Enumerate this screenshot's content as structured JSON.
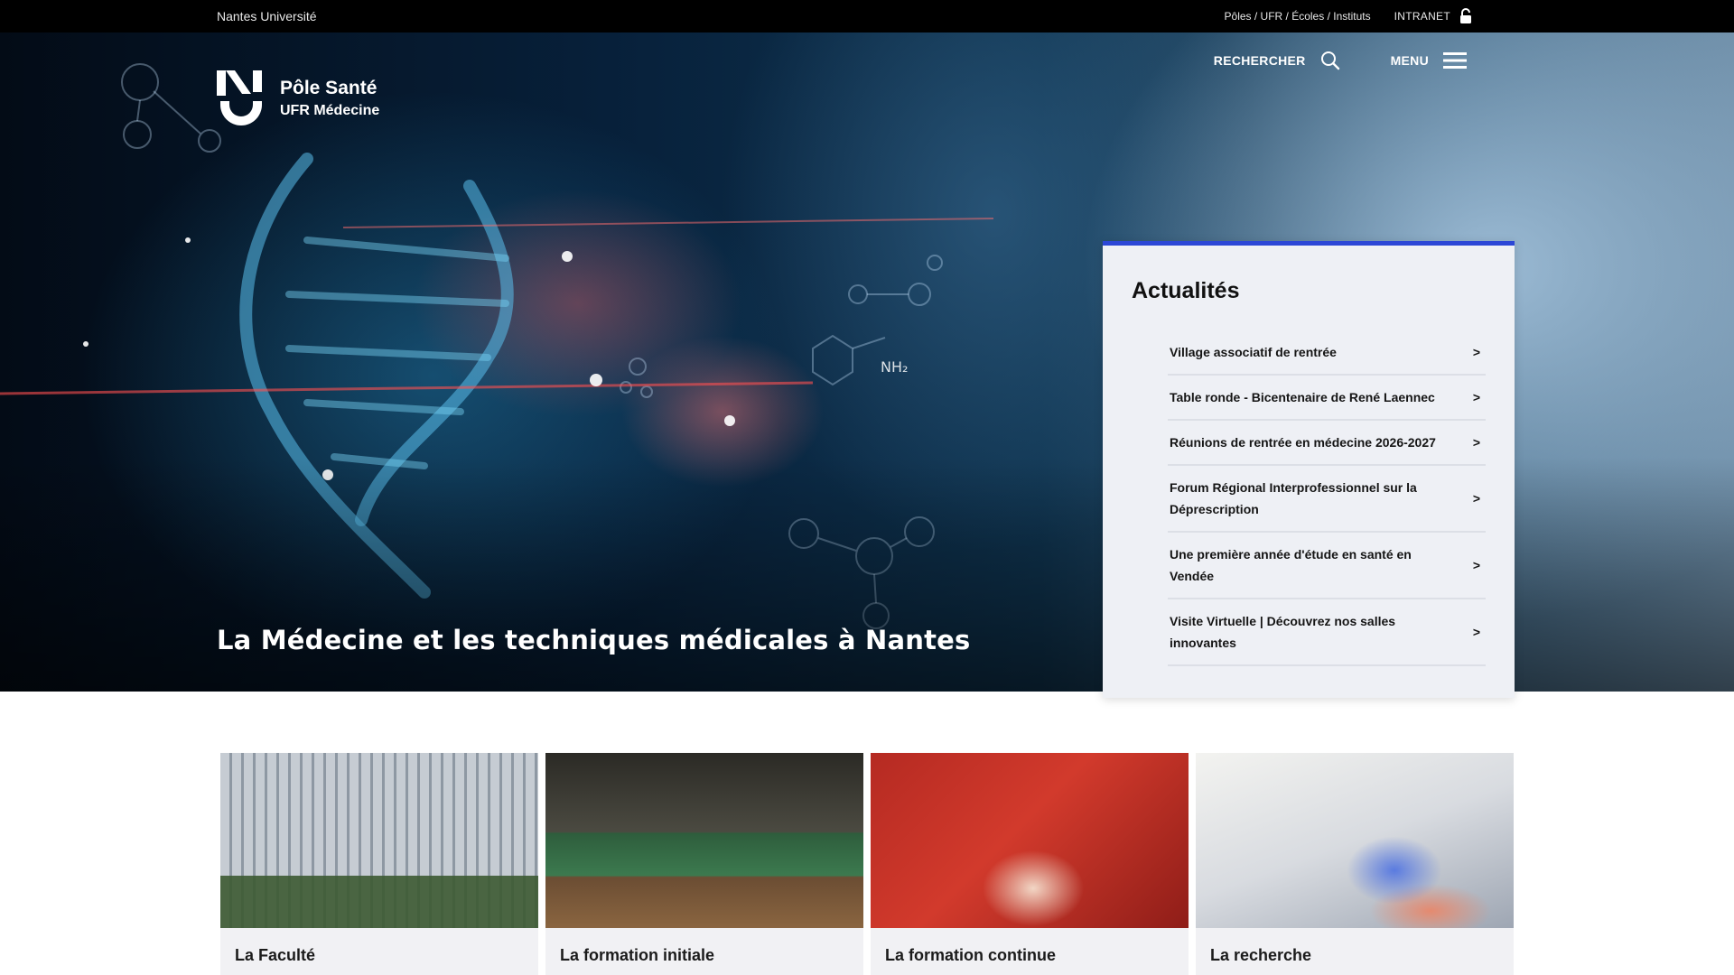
{
  "topbar": {
    "university": "Nantes Université",
    "poles_link": "Pôles / UFR / Écoles / Instituts",
    "intranet": "INTRANET"
  },
  "header": {
    "brand_title": "Pôle Santé",
    "brand_subtitle": "UFR Médecine",
    "search_label": "RECHERCHER",
    "menu_label": "MENU"
  },
  "hero": {
    "title": "La Médecine et les techniques médicales à Nantes"
  },
  "news": {
    "heading": "Actualités",
    "items": [
      {
        "label": "Village associatif de rentrée"
      },
      {
        "label": "Table ronde - Bicentenaire de René Laennec"
      },
      {
        "label": "Réunions de rentrée en médecine 2026-2027"
      },
      {
        "label": "Forum Régional Interprofessionnel sur la Déprescription"
      },
      {
        "label": "Une première année d'étude en santé en Vendée"
      },
      {
        "label": "Visite Virtuelle | Découvrez nos salles innovantes"
      }
    ],
    "chevron": ">"
  },
  "cards": [
    {
      "label": "La Faculté"
    },
    {
      "label": "La formation initiale"
    },
    {
      "label": "La formation continue"
    },
    {
      "label": "La recherche"
    }
  ],
  "colors": {
    "topbar_bg": "#000000",
    "news_accent": "#2c47d6",
    "news_bg": "#eef0f5"
  },
  "icons": {
    "lock": "lock-icon",
    "search": "search-icon",
    "menu": "hamburger-icon",
    "chevron": "chevron-right-icon"
  }
}
